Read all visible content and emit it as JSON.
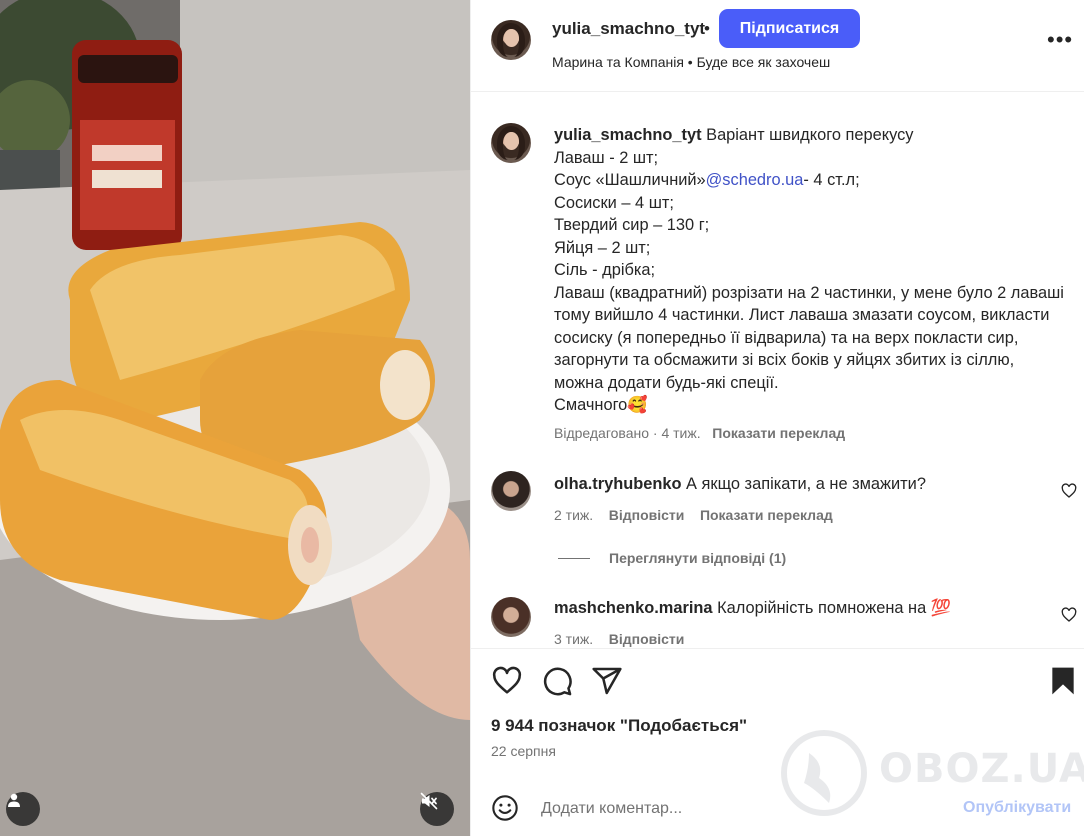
{
  "header": {
    "username": "yulia_smachno_tyt",
    "separator": "•",
    "follow_label": "Підписатися",
    "subtitle": "Марина та Компанія • Буде все як захочеш",
    "more_icon": "more-horizontal-icon"
  },
  "caption": {
    "username": "yulia_smachno_tyt",
    "text_before_mention": " Варіант швидкого перекусу\nЛаваш - 2 шт;\nСоус «Шашличний»",
    "mention": "@schedro.ua",
    "text_after_mention": "- 4 ст.л;\nСосиски – 4 шт;\nТвердий сир – 130 г;\nЯйця – 2 шт;\nСіль - дрібка;\nЛаваш (квадратний) розрізати на 2 частинки, у мене було 2 лаваші тому вийшло 4 частинки. Лист лаваша змазати соусом, викласти сосиску (я попередньо її відварила) та на верх покласти сир, загорнути та обсмажити зі всіх боків у яйцях збитих із сіллю, можна додати будь-які спеції.\nСмачного🥰",
    "edited": "Відредаговано",
    "time": "· 4 тиж.",
    "translate": "Показати переклад"
  },
  "comments": [
    {
      "username": "olha.tryhubenko",
      "text": " А якщо запікати, а не змажити?",
      "time": "2 тиж.",
      "reply": "Відповісти",
      "translate": "Показати переклад",
      "view_replies": "Переглянути відповіді (1)"
    },
    {
      "username": "mashchenko.marina",
      "text": " Калорійність помножена на 💯",
      "time": "3 тиж.",
      "reply": "Відповісти"
    }
  ],
  "actions": {
    "likes": "9 944 позначок \"Подобається\"",
    "date": "22 серпня",
    "icons": [
      "heart-icon",
      "comment-icon",
      "share-icon",
      "bookmark-icon"
    ]
  },
  "composer": {
    "placeholder": "Додати коментар...",
    "post_label": "Опублікувати"
  },
  "watermark": "OBOZ.UA",
  "colors": {
    "accent": "#4a5df9",
    "link": "#4052c7",
    "muted": "#737373",
    "post_disabled": "#b2c5f7"
  }
}
